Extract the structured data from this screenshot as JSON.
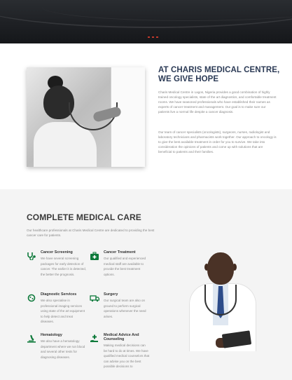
{
  "intro": {
    "title": "AT CHARIS MEDICAL CENTRE, WE GIVE HOPE",
    "paragraph1": "Charis Medical Centre in Lagos, Nigeria provides a good combination of highly trained oncology specialists, state of the art diagnostics, and comfortable treatment rooms. We have seasoned professionals who have established their names as experts of cancer treatment and management. Our goal is to make sure our patients live a normal life despite a cancer diagnosis.",
    "paragraph2": "Our team of cancer specialists (oncologists), surgeons, nurses, radiologist and laboratory technicians and pharmacists work together. Our approach to oncology is to give the best available treatment in order for you to survive. We take into consideration the opinions of patients and come up with solutions that are beneficial to patients and their families."
  },
  "care": {
    "title": "COMPLETE MEDICAL CARE",
    "lead": "Our healthcare professionals at Charis Medical Centre are dedicated to providing the best cancer care for patients.",
    "services": [
      {
        "title": "Cancer Screening",
        "text": "We have several screening packages for early detection of cancer. The earlier it is detected, the better the prognosis.",
        "icon": "stethoscope-icon"
      },
      {
        "title": "Cancer Treatment",
        "text": "Our qualified and experienced medical staff are available to provide the best treatment options.",
        "icon": "medical-bag-icon"
      },
      {
        "title": "Diagnostic Services",
        "text": "We also specialise in professional imaging services using state of the art equipment to help detect and treat diseases.",
        "icon": "virus-icon"
      },
      {
        "title": "Surgery",
        "text": "Our surgical team are also on ground to perform surgical operations whenever the need arises.",
        "icon": "ambulance-icon"
      },
      {
        "title": "Hematology",
        "text": "We also have a hematology department where we run blood and several other tests for diagnosing diseases.",
        "icon": "microscope-icon"
      },
      {
        "title": "Medical Advice And Counseling",
        "text": "Making medical decisions can be hard to do at times. We have qualified medical counselors that can advise you on the best possible decisions to",
        "icon": "hand-care-icon"
      }
    ]
  },
  "colors": {
    "accent": "#0e7a3b",
    "heading": "#2b3a55",
    "slider_dot": "#c0392b"
  }
}
